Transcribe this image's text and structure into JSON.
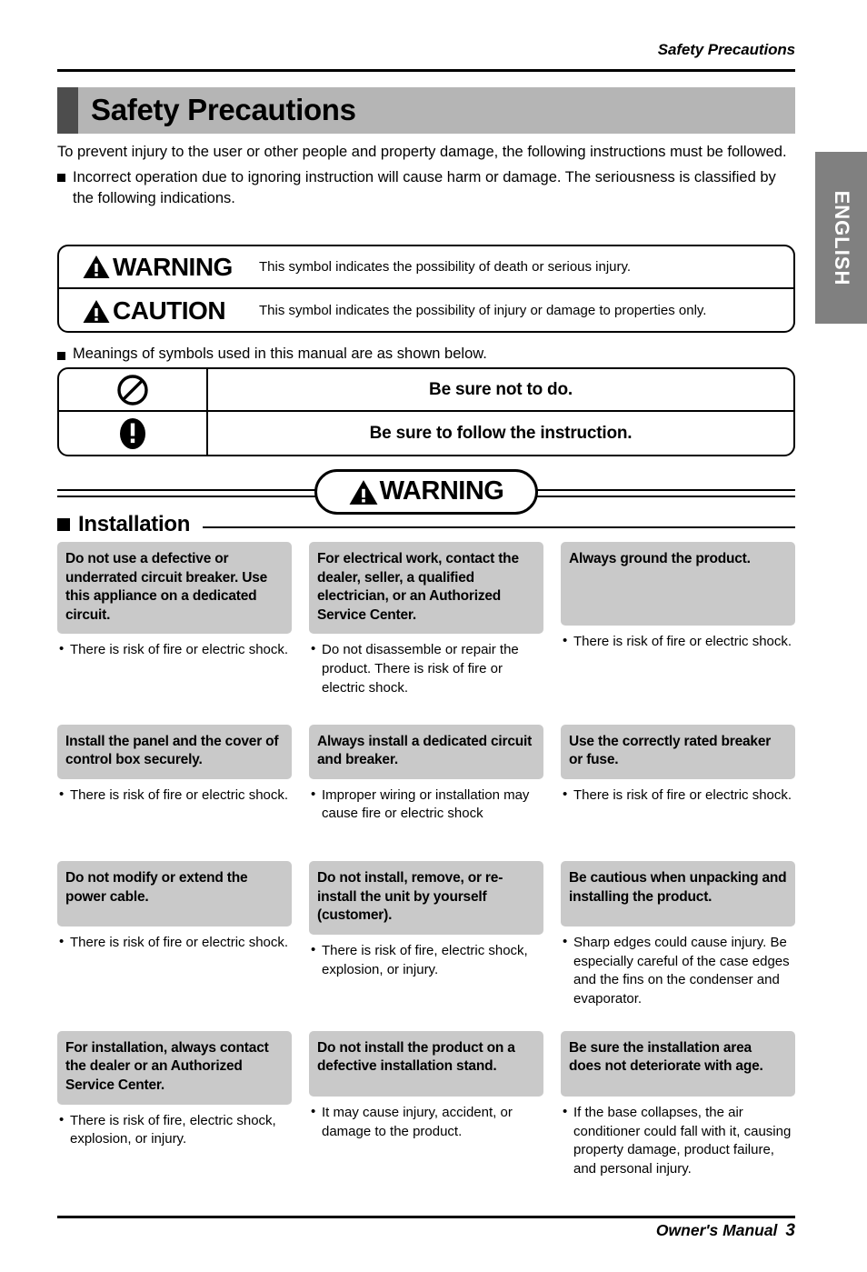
{
  "header": {
    "running_title": "Safety Precautions"
  },
  "side_tab": {
    "label": "ENGLISH",
    "bg_color": "#808080",
    "text_color": "#ffffff"
  },
  "title_bar": {
    "title": "Safety Precautions",
    "bg_color": "#b5b5b5",
    "marker_color": "#4d4d4d"
  },
  "intro": {
    "paragraph": "To prevent injury to the user or other people and property damage, the following instructions must be followed.",
    "bullet": "Incorrect operation due to ignoring instruction will cause harm or damage. The seriousness is classified by the following indications."
  },
  "definitions": {
    "rows": [
      {
        "icon": "warning-triangle-icon",
        "label": "WARNING",
        "description": "This symbol indicates the possibility of death or serious injury."
      },
      {
        "icon": "warning-triangle-icon",
        "label": "CAUTION",
        "description": "This symbol indicates the possibility of injury or damage to properties only."
      }
    ]
  },
  "symbols": {
    "heading": "Meanings of symbols used in this manual are as shown below.",
    "rows": [
      {
        "icon": "prohibition-icon",
        "text": "Be sure not to do."
      },
      {
        "icon": "mandatory-exclamation-icon",
        "text": "Be sure to follow the instruction."
      }
    ]
  },
  "banner": {
    "icon": "warning-triangle-icon",
    "label": "WARNING"
  },
  "section": {
    "marker": "square-bullet-icon",
    "title": "Installation"
  },
  "items": [
    [
      {
        "head": "Do not use a defective or underrated circuit breaker. Use this appliance on a dedicated circuit.",
        "body": [
          "There is risk of fire or electric shock."
        ]
      },
      {
        "head": "For electrical work, contact the dealer, seller, a qualified electrician, or an Authorized Service Center.",
        "body": [
          "Do not disassemble or repair the product. There is risk of fire or electric shock."
        ]
      },
      {
        "head": "Always ground the product.",
        "body": [
          "There is risk of fire or electric shock."
        ]
      }
    ],
    [
      {
        "head": "Install the panel and the cover of control box securely.",
        "body": [
          "There is risk of fire or electric shock."
        ]
      },
      {
        "head": "Always install a dedicated circuit and breaker.",
        "body": [
          "Improper wiring or installation may cause fire or electric shock"
        ]
      },
      {
        "head": "Use the correctly rated breaker or fuse.",
        "body": [
          "There is risk of fire or electric shock."
        ]
      }
    ],
    [
      {
        "head": "Do not modify or extend the power cable.",
        "body": [
          "There is risk of fire or electric shock."
        ]
      },
      {
        "head": "Do not install, remove, or re-install the unit by yourself (customer).",
        "body": [
          "There is risk of fire, electric shock, explosion, or injury."
        ]
      },
      {
        "head": "Be cautious when unpacking and installing  the product.",
        "body": [
          "Sharp edges could cause injury. Be especially careful of the case edges and the fins on the condenser and evaporator."
        ]
      }
    ],
    [
      {
        "head": "For installation, always contact the dealer or an Authorized Service Center.",
        "body": [
          "There is risk of fire, electric shock, explosion, or injury."
        ]
      },
      {
        "head": "Do not install the product on a defective installation stand.",
        "body": [
          "It may cause injury, accident, or damage to the product."
        ]
      },
      {
        "head": "Be sure the installation area does not deteriorate with age.",
        "body": [
          "If the base collapses, the air conditioner could fall with it, causing property damage, product failure, and personal injury."
        ]
      }
    ]
  ],
  "footer": {
    "label": "Owner's Manual",
    "page": "3"
  }
}
